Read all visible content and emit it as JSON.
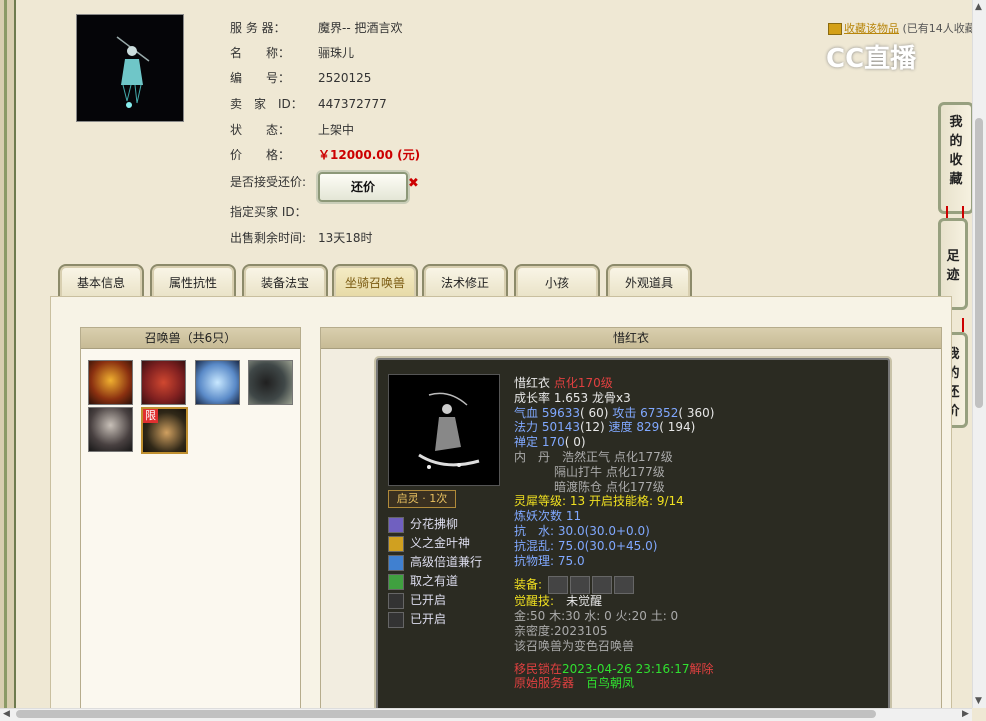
{
  "item": {
    "server_label": "服 务 器：",
    "server": "魔界-- 把酒言欢",
    "name_label": "名　　称：",
    "name": "骊珠儿",
    "id_label": "编　　号：",
    "id": "2520125",
    "seller_label": "卖　家　ID：",
    "seller_id": "447372777",
    "status_label": "状　　态：",
    "status": "上架中",
    "price_label": "价　　格：",
    "price": "￥12000.00 (元)",
    "bargain_label": "是否接受还价:",
    "bargain_button": "还价",
    "bargain_x": "✖",
    "buyer_label": "指定买家 ID：",
    "remain_label": "出售剩余时间:",
    "remain": "13天18时"
  },
  "fav": {
    "link": "收藏该物品",
    "count": "(已有14人收藏"
  },
  "logo": "CC直播",
  "side_tabs": [
    {
      "chars": [
        "我",
        "的",
        "收",
        "藏"
      ]
    },
    {
      "chars": [
        "足",
        "迹"
      ]
    },
    {
      "chars": [
        "我",
        "的",
        "还",
        "价"
      ]
    }
  ],
  "tabs": [
    "基本信息",
    "属性抗性",
    "装备法宝",
    "坐骑召唤兽",
    "法术修正",
    "小孩",
    "外观道具"
  ],
  "pet_list": {
    "title": "召唤兽（共6只）",
    "limit_badge": "限"
  },
  "detail": {
    "title": "惜红衣",
    "qiling": "启灵 · 1次",
    "skills": [
      "分花拂柳",
      "义之金叶神",
      "高级倍道兼行",
      "取之有道",
      "已开启",
      "已开启"
    ],
    "lines": {
      "name": "惜红衣",
      "name_level": "点化170级",
      "growth": "成长率 1.653 龙骨x3",
      "hp_k": "气血",
      "hp_v": "59633",
      "hp_p": "( 60)",
      "atk_k": "攻击",
      "atk_v": "67352",
      "atk_p": "( 360)",
      "mp_k": "法力",
      "mp_v": "50143",
      "mp_p": "(12)",
      "spd_k": "速度",
      "spd_v": "829",
      "spd_p": "( 194)",
      "def_k": "禅定",
      "def_v": "170",
      "def_p": "( 0)",
      "dan_label": "内　丹",
      "dan1": "浩然正气 点化177级",
      "dan2": "隔山打牛 点化177级",
      "dan3": "暗渡陈仓 点化177级",
      "lingxi_k": "灵犀等级:",
      "lingxi_v": "13 开启技能格: 9/14",
      "lianyao": "炼妖次数 11",
      "res_water_k": "抗　水:",
      "res_water_v": "30.0(30.0+0.0)",
      "res_chaos_k": "抗混乱:",
      "res_chaos_v": "75.0(30.0+45.0)",
      "res_phys_k": "抗物理:",
      "res_phys_v": "75.0",
      "equip_k": "装备:",
      "awake_k": "觉醒技:",
      "awake_v": "未觉醒",
      "elements": "金:50 木:30 水: 0 火:20 土: 0",
      "intimacy": "亲密度:2023105",
      "variant": "该召唤兽为变色召唤兽",
      "migrate_k": "移民锁在",
      "migrate_date": "2023-04-26 23:16:17",
      "migrate_t": "解除",
      "origin_k": "原始服务器",
      "origin_v": "百鸟朝凤"
    }
  }
}
